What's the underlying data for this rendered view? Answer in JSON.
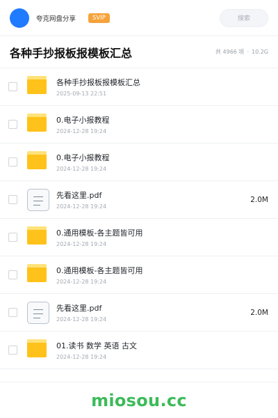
{
  "topbar": {
    "site_name": "夸克网盘分享",
    "badge": "SVIP",
    "search_placeholder": "搜索",
    "avatar_color": "#1f7bff",
    "badge_color": "#f7a23b"
  },
  "header": {
    "title": "各种手抄报板报模板汇总",
    "count": "共 4966 项",
    "separator": "·",
    "total_size": "10.2G"
  },
  "files": [
    {
      "type": "folder",
      "icon": "folder-icon",
      "name": "各种手抄报板报模板汇总",
      "date": "2025-09-13 22:51",
      "size": ""
    },
    {
      "type": "folder",
      "icon": "folder-icon",
      "name": "0.电子小报教程",
      "date": "2024-12-28 19:24",
      "size": ""
    },
    {
      "type": "folder",
      "icon": "folder-icon",
      "name": "0.电子小报教程",
      "date": "2024-12-28 19:24",
      "size": ""
    },
    {
      "type": "file",
      "icon": "document-icon",
      "name": "先看这里.pdf",
      "date": "2024-12-28 19:24",
      "size": "2.0M"
    },
    {
      "type": "folder",
      "icon": "folder-icon",
      "name": "0.通用模板-各主题皆可用",
      "date": "2024-12-28 19:24",
      "size": ""
    },
    {
      "type": "folder",
      "icon": "folder-icon",
      "name": "0.通用模板-各主题皆可用",
      "date": "2024-12-28 19:24",
      "size": ""
    },
    {
      "type": "file",
      "icon": "document-icon",
      "name": "先看这里.pdf",
      "date": "2024-12-28 19:24",
      "size": "2.0M"
    },
    {
      "type": "folder",
      "icon": "folder-icon",
      "name": "01.读书 数学 英语 古文",
      "date": "2024-12-28 19:24",
      "size": ""
    }
  ],
  "footer": {
    "watermark": "miosou.cc",
    "watermark_color": "#3dbb5a"
  }
}
